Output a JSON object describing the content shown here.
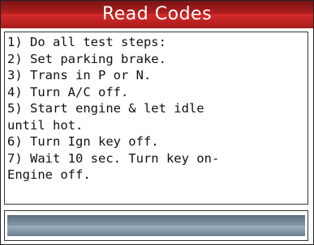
{
  "title": "Read Codes",
  "colors": {
    "title_bar": "#b01e1e",
    "status_bar": "#7f93a5"
  },
  "instructions": [
    "1) Do all test steps:",
    "2) Set parking brake.",
    "3) Trans in P or N.",
    "4) Turn A/C off.",
    "5) Start engine & let idle",
    "until hot.",
    "6) Turn Ign key off.",
    "7) Wait 10 sec. Turn key on-",
    "Engine off."
  ]
}
